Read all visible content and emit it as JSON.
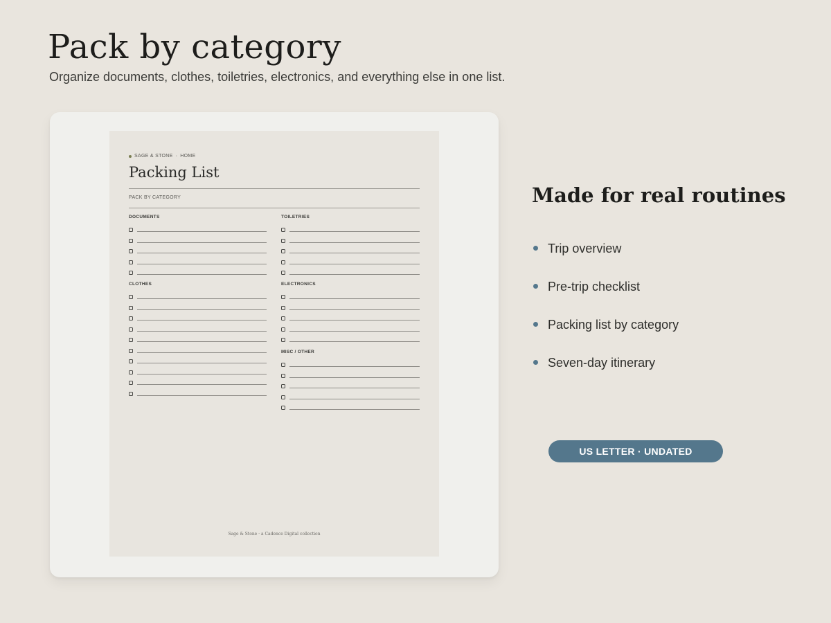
{
  "header": {
    "title": "Pack by category",
    "subtitle": "Organize documents, clothes, toiletries, electronics, and everything else in one list."
  },
  "preview": {
    "brand": "SAGE & STONE",
    "brand_sep": "·",
    "brand_section": "HOME",
    "title": "Packing List",
    "subtitle": "PACK BY CATEGORY",
    "sections": [
      {
        "heading": "DOCUMENTS",
        "rows": 5
      },
      {
        "heading": "TOILETRIES",
        "rows": 5
      },
      {
        "heading": "CLOTHES",
        "rows": 10
      },
      {
        "heading": "ELECTRONICS",
        "rows": 5
      },
      {
        "heading": "MISC / OTHER",
        "rows": 5
      }
    ],
    "footer": "Sage & Stone  ·  a Cadence Digital collection"
  },
  "sidebar": {
    "title": "Made for real routines",
    "features": [
      "Trip overview",
      "Pre-trip checklist",
      "Packing list by category",
      "Seven-day itinerary"
    ]
  },
  "badge": {
    "label": "US LETTER · UNDATED"
  },
  "colors": {
    "accent": "#54778c",
    "background": "#e9e5de"
  }
}
